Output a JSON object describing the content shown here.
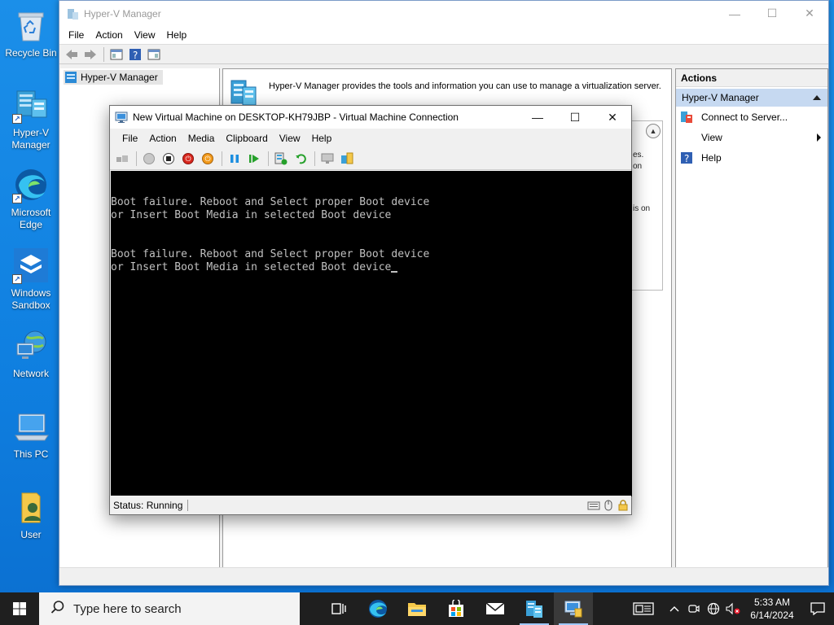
{
  "desktop": {
    "icons": [
      {
        "name": "recycle-bin",
        "label": "Recycle Bin"
      },
      {
        "name": "hyperv-manager",
        "label": "Hyper-V Manager"
      },
      {
        "name": "microsoft-edge",
        "label": "Microsoft Edge"
      },
      {
        "name": "windows-sandbox",
        "label": "Windows Sandbox"
      },
      {
        "name": "network",
        "label": "Network"
      },
      {
        "name": "this-pc",
        "label": "This PC"
      },
      {
        "name": "user",
        "label": "User"
      }
    ]
  },
  "hyperv": {
    "title": "Hyper-V Manager",
    "menu": [
      "File",
      "Action",
      "View",
      "Help"
    ],
    "tree_item": "Hyper-V Manager",
    "description": "Hyper-V Manager provides the tools and information you can use to manage a virtualization server.",
    "panel_snippets": [
      "es.",
      "on",
      "is on"
    ],
    "actions": {
      "header": "Actions",
      "section": "Hyper-V Manager",
      "items": [
        {
          "label": "Connect to Server...",
          "icon": "connect-server-icon"
        },
        {
          "label": "View",
          "icon": "none",
          "submenu": true
        },
        {
          "label": "Help",
          "icon": "help-icon"
        }
      ]
    }
  },
  "vm": {
    "title": "New Virtual Machine on DESKTOP-KH79JBP - Virtual Machine Connection",
    "menu": [
      "File",
      "Action",
      "Media",
      "Clipboard",
      "View",
      "Help"
    ],
    "console": [
      "Boot failure. Reboot and Select proper Boot device",
      "or Insert Boot Media in selected Boot device",
      "Boot failure. Reboot and Select proper Boot device",
      "or Insert Boot Media in selected Boot device"
    ],
    "status": "Status: Running"
  },
  "taskbar": {
    "search_placeholder": "Type here to search",
    "time": "5:33 AM",
    "date": "6/14/2024"
  },
  "colors": {
    "desktop": "#1b8fe9",
    "selection": "#c6d9f1",
    "taskbar": "#1f1f1f"
  }
}
